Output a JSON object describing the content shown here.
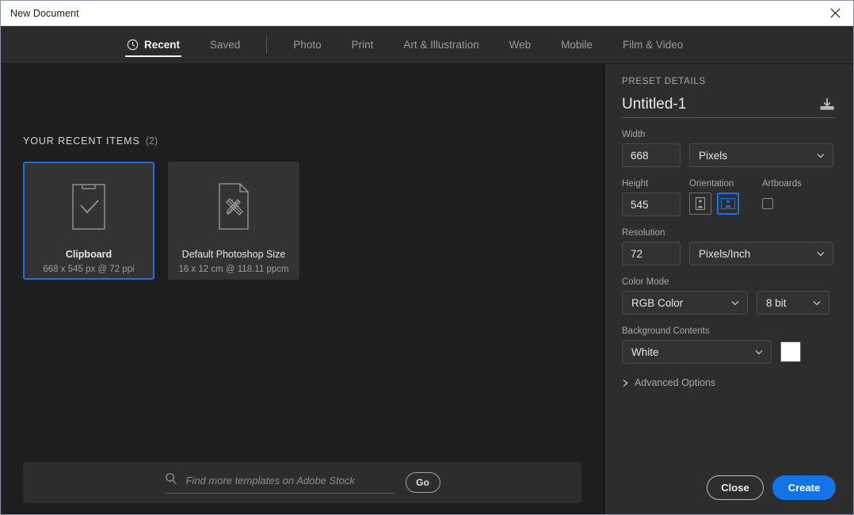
{
  "window": {
    "title": "New Document",
    "close_icon": "close-icon"
  },
  "tabs": [
    {
      "label": "Recent",
      "icon": "clock-icon",
      "active": true
    },
    {
      "label": "Saved",
      "active": false
    },
    {
      "label": "Photo",
      "active": false
    },
    {
      "label": "Print",
      "active": false
    },
    {
      "label": "Art & Illustration",
      "active": false
    },
    {
      "label": "Web",
      "active": false
    },
    {
      "label": "Mobile",
      "active": false
    },
    {
      "label": "Film & Video",
      "active": false
    }
  ],
  "recent": {
    "heading": "YOUR RECENT ITEMS",
    "count": "(2)",
    "items": [
      {
        "name": "Clipboard",
        "details": "668 x 545 px @ 72 ppi",
        "icon": "clipboard-check-icon",
        "selected": true
      },
      {
        "name": "Default Photoshop Size",
        "details": "16 x 12 cm @ 118.11 ppcm",
        "icon": "document-pencil-ruler-icon",
        "selected": false
      }
    ]
  },
  "stock": {
    "placeholder": "Find more templates on Adobe Stock",
    "value": "",
    "search_icon": "search-icon",
    "go_label": "Go"
  },
  "preset": {
    "section_label": "PRESET DETAILS",
    "name_value": "Untitled-1",
    "save_icon": "save-preset-icon",
    "width": {
      "label": "Width",
      "value": "668"
    },
    "units": {
      "value": "Pixels"
    },
    "height": {
      "label": "Height",
      "value": "545"
    },
    "orientation": {
      "label": "Orientation",
      "portrait_icon": "portrait-orientation-icon",
      "landscape_icon": "landscape-orientation-icon",
      "selected": "landscape"
    },
    "artboards": {
      "label": "Artboards",
      "checked": false
    },
    "resolution": {
      "label": "Resolution",
      "value": "72"
    },
    "resolution_units": {
      "value": "Pixels/Inch"
    },
    "color_mode": {
      "label": "Color Mode",
      "value": "RGB Color"
    },
    "bit_depth": {
      "value": "8 bit"
    },
    "background": {
      "label": "Background Contents",
      "value": "White",
      "swatch_color": "#ffffff"
    },
    "advanced": {
      "label": "Advanced Options",
      "icon": "chevron-right-icon"
    }
  },
  "footer": {
    "close_label": "Close",
    "create_label": "Create"
  },
  "colors": {
    "accent": "#1473e6",
    "panel_bg": "#2d2d2d",
    "content_bg": "#1e1e1e",
    "card_bg": "#333333"
  }
}
